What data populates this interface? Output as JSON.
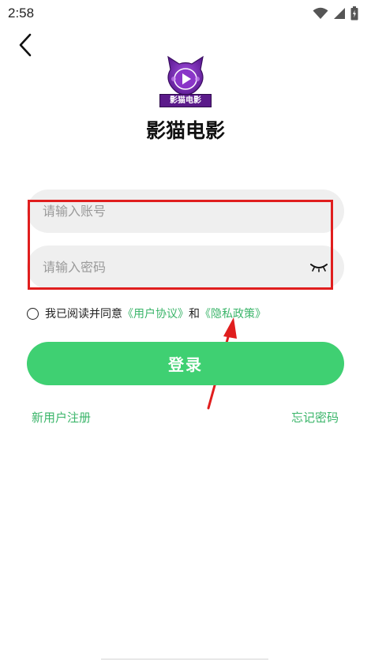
{
  "status_bar": {
    "time": "2:58",
    "icons": [
      "wifi-icon",
      "signal-icon",
      "battery-icon"
    ]
  },
  "header": {
    "back_icon": "chevron-left-icon",
    "logo_badge_text": "影猫电影",
    "app_name": "影猫电影"
  },
  "form": {
    "account_placeholder": "请输入账号",
    "account_value": "",
    "password_placeholder": "请输入密码",
    "password_value": "",
    "password_toggle_icon": "eye-closed-icon"
  },
  "agreement": {
    "checked": false,
    "prefix": "我已阅读并同意",
    "user_agreement": "《用户协议》",
    "conjunction": "和",
    "privacy_policy": "《隐私政策》"
  },
  "actions": {
    "login_label": "登录",
    "register_label": "新用户注册",
    "forgot_label": "忘记密码"
  },
  "colors": {
    "accent_green": "#3fd072",
    "link_green": "#3bb56a",
    "highlight_red": "#e01e1e",
    "input_bg": "#efefef",
    "logo_purple": "#7a2bb5"
  }
}
